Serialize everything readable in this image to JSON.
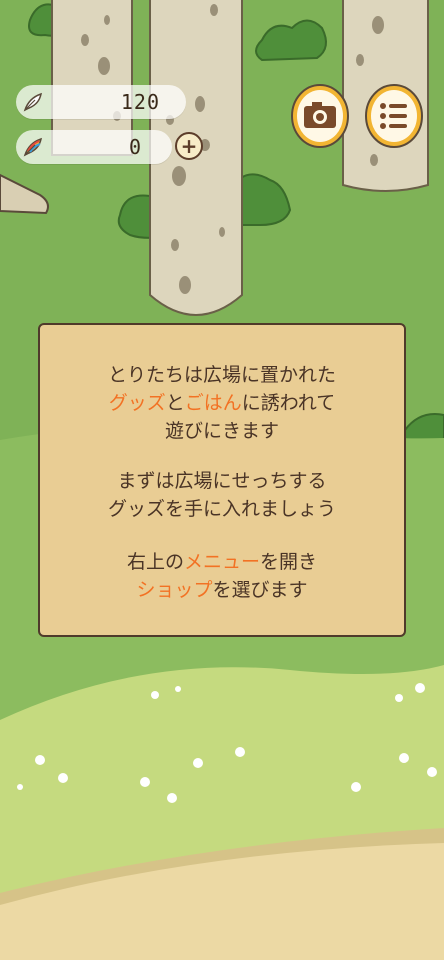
{
  "hud": {
    "feathers": "120",
    "rainbow_feathers": "0",
    "plus_label": "+"
  },
  "dialog": {
    "line1": "とりたちは広場に置かれた",
    "line2_hl1": "グッズ",
    "line2_mid": "と",
    "line2_hl2": "ごはん",
    "line2_end": "に誘われて",
    "line3": "遊びにきます",
    "line4": "まずは広場にせっちする",
    "line5": "グッズを手に入れましょう",
    "line6_start": "右上の",
    "line6_hl": "メニュー",
    "line6_end": "を開き",
    "line7_hl": "ショップ",
    "line7_end": "を選びます"
  },
  "colors": {
    "highlight": "#f27224",
    "dialog_bg": "#e9cd94",
    "grass": "#7fb257",
    "meadow": "#c5da7f",
    "path": "#ecd9a4"
  },
  "icons": [
    "feather-icon",
    "rainbow-feather-icon",
    "plus-icon",
    "camera-icon",
    "menu-list-icon"
  ]
}
